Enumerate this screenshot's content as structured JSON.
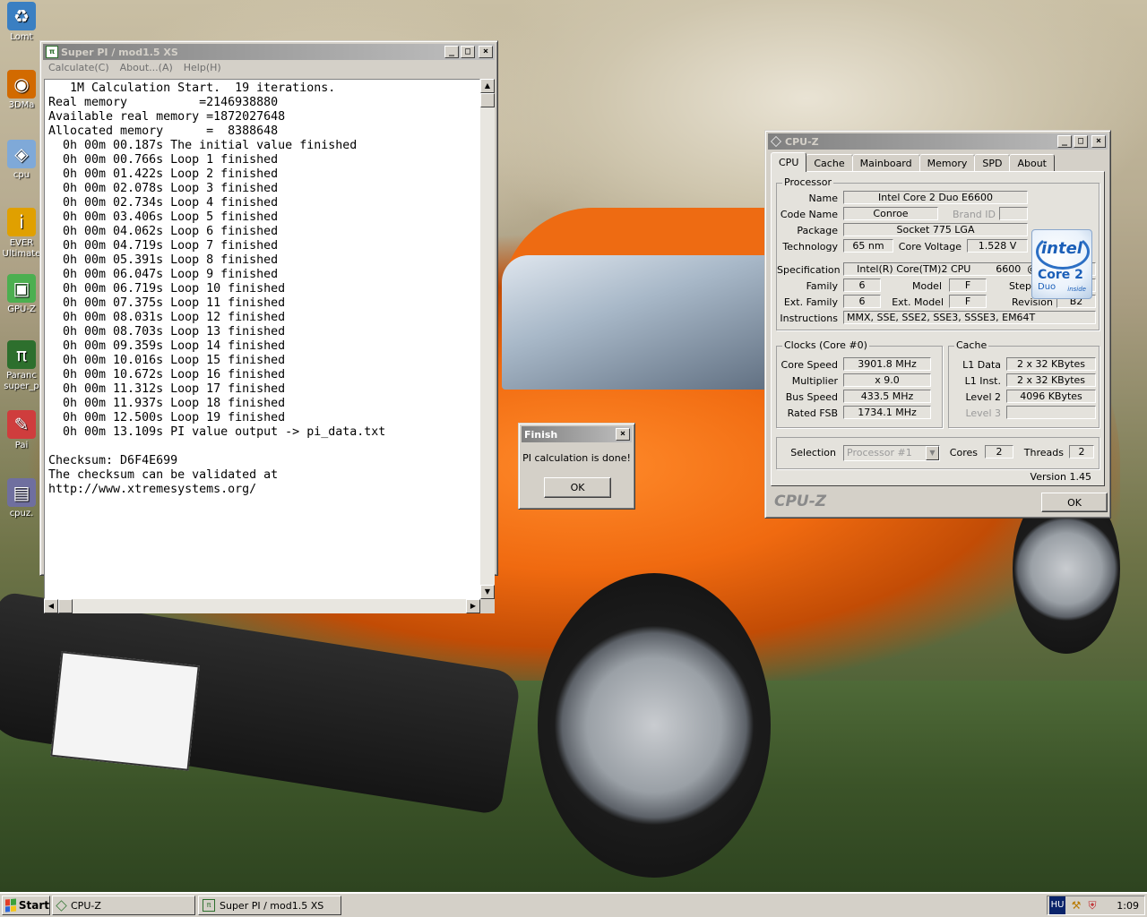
{
  "desktop_icons": [
    {
      "name": "recycle-bin",
      "label": "Lomt",
      "color": "#3a7fc2",
      "glyph": "♻"
    },
    {
      "name": "3dmark",
      "label": "3DMa",
      "color": "#d26a00",
      "glyph": "◉"
    },
    {
      "name": "cpuz-shortcut",
      "label": "cpu",
      "color": "#7fa9d8",
      "glyph": "◈"
    },
    {
      "name": "everest",
      "label": "EVER\nUltimate",
      "color": "#e0a000",
      "glyph": "i"
    },
    {
      "name": "gpuz",
      "label": "GPU-Z",
      "color": "#4caf50",
      "glyph": "▣"
    },
    {
      "name": "superpi-shortcut",
      "label": "Paranc\nsuper_p",
      "color": "#2d6f2d",
      "glyph": "π"
    },
    {
      "name": "paint",
      "label": "Pai",
      "color": "#cf3d3d",
      "glyph": "✎"
    },
    {
      "name": "cpuz-file",
      "label": "cpuz.",
      "color": "#6f6f9f",
      "glyph": "▤"
    }
  ],
  "superpi": {
    "title": "Super PI / mod1.5 XS",
    "menu": [
      "Calculate(C)",
      "About...(A)",
      "Help(H)"
    ],
    "output": "   1M Calculation Start.  19 iterations.\nReal memory          =2146938880\nAvailable real memory =1872027648\nAllocated memory      =  8388648\n  0h 00m 00.187s The initial value finished\n  0h 00m 00.766s Loop 1 finished\n  0h 00m 01.422s Loop 2 finished\n  0h 00m 02.078s Loop 3 finished\n  0h 00m 02.734s Loop 4 finished\n  0h 00m 03.406s Loop 5 finished\n  0h 00m 04.062s Loop 6 finished\n  0h 00m 04.719s Loop 7 finished\n  0h 00m 05.391s Loop 8 finished\n  0h 00m 06.047s Loop 9 finished\n  0h 00m 06.719s Loop 10 finished\n  0h 00m 07.375s Loop 11 finished\n  0h 00m 08.031s Loop 12 finished\n  0h 00m 08.703s Loop 13 finished\n  0h 00m 09.359s Loop 14 finished\n  0h 00m 10.016s Loop 15 finished\n  0h 00m 10.672s Loop 16 finished\n  0h 00m 11.312s Loop 17 finished\n  0h 00m 11.937s Loop 18 finished\n  0h 00m 12.500s Loop 19 finished\n  0h 00m 13.109s PI value output -> pi_data.txt\n\nChecksum: D6F4E699\nThe checksum can be validated at\nhttp://www.xtremesystems.org/"
  },
  "finish_dialog": {
    "title": "Finish",
    "message": "PI calculation is done!",
    "ok_label": "OK"
  },
  "cpuz": {
    "title": "CPU-Z",
    "tabs": [
      "CPU",
      "Cache",
      "Mainboard",
      "Memory",
      "SPD",
      "About"
    ],
    "active_tab": "CPU",
    "processor": {
      "group_label": "Processor",
      "name_label": "Name",
      "name": "Intel Core 2 Duo E6600",
      "codename_label": "Code Name",
      "codename": "Conroe",
      "brandid_label": "Brand ID",
      "brandid": "",
      "package_label": "Package",
      "package": "Socket 775 LGA",
      "technology_label": "Technology",
      "technology": "65 nm",
      "voltage_label": "Core Voltage",
      "voltage": "1.528 V",
      "spec_label": "Specification",
      "spec": "Intel(R) Core(TM)2 CPU        6600  @ 2.40GHz",
      "family_label": "Family",
      "family": "6",
      "model_label": "Model",
      "model": "F",
      "stepping_label": "Stepping",
      "stepping": "6",
      "extfamily_label": "Ext. Family",
      "extfamily": "6",
      "extmodel_label": "Ext. Model",
      "extmodel": "F",
      "revision_label": "Revision",
      "revision": "B2",
      "instructions_label": "Instructions",
      "instructions": "MMX, SSE, SSE2, SSE3, SSSE3, EM64T"
    },
    "logo": {
      "brand": "intel",
      "line1": "Core 2",
      "line2": "Duo",
      "line3": "inside"
    },
    "clocks": {
      "group_label": "Clocks (Core #0)",
      "core_speed_label": "Core Speed",
      "core_speed": "3901.8 MHz",
      "multiplier_label": "Multiplier",
      "multiplier": "x 9.0",
      "bus_speed_label": "Bus Speed",
      "bus_speed": "433.5 MHz",
      "rated_fsb_label": "Rated FSB",
      "rated_fsb": "1734.1 MHz"
    },
    "cache": {
      "group_label": "Cache",
      "l1d_label": "L1 Data",
      "l1d": "2 x 32 KBytes",
      "l1i_label": "L1 Inst.",
      "l1i": "2 x 32 KBytes",
      "l2_label": "Level 2",
      "l2": "4096 KBytes",
      "l3_label": "Level 3",
      "l3": ""
    },
    "selection_label": "Selection",
    "selection": "Processor #1",
    "cores_label": "Cores",
    "cores": "2",
    "threads_label": "Threads",
    "threads": "2",
    "version": "Version 1.45",
    "brand_text": "CPU-Z",
    "ok_label": "OK"
  },
  "taskbar": {
    "start_label": "Start",
    "buttons": [
      {
        "label": "CPU-Z"
      },
      {
        "label": "Super PI / mod1.5 XS"
      }
    ],
    "lang": "HU",
    "clock": "1:09"
  }
}
